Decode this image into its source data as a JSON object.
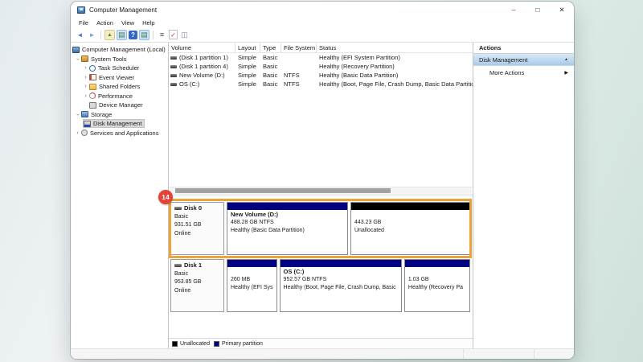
{
  "window": {
    "title": "Computer Management",
    "controls": {
      "minimize": "–",
      "maximize": "□",
      "close": "✕"
    }
  },
  "menu": {
    "items": [
      "File",
      "Action",
      "View",
      "Help"
    ]
  },
  "toolbar": {
    "icons": [
      {
        "name": "back-icon",
        "glyph": "◄"
      },
      {
        "name": "forward-icon",
        "glyph": "►"
      },
      {
        "name": "up-level-icon",
        "glyph": "▲"
      },
      {
        "name": "show-console-tree-icon",
        "glyph": "▤"
      },
      {
        "name": "help-icon",
        "glyph": "?"
      },
      {
        "name": "show-action-pane-icon",
        "glyph": "▤"
      },
      {
        "name": "popup-menu-icon",
        "glyph": "≡"
      },
      {
        "name": "properties-check-icon",
        "glyph": "✓"
      },
      {
        "name": "console-panel-icon",
        "glyph": "◫"
      }
    ]
  },
  "tree": {
    "items": [
      {
        "label": "Computer Management (Local)"
      },
      {
        "label": "System Tools"
      },
      {
        "label": "Task Scheduler"
      },
      {
        "label": "Event Viewer"
      },
      {
        "label": "Shared Folders"
      },
      {
        "label": "Performance"
      },
      {
        "label": "Device Manager"
      },
      {
        "label": "Storage"
      },
      {
        "label": "Disk Management"
      },
      {
        "label": "Services and Applications"
      }
    ]
  },
  "volume_list": {
    "columns": [
      "Volume",
      "Layout",
      "Type",
      "File System",
      "Status"
    ],
    "rows": [
      {
        "name": "(Disk 1 partition 1)",
        "layout": "Simple",
        "type": "Basic",
        "fs": "",
        "status": "Healthy (EFI System Partition)"
      },
      {
        "name": "(Disk 1 partition 4)",
        "layout": "Simple",
        "type": "Basic",
        "fs": "",
        "status": "Healthy (Recovery Partition)"
      },
      {
        "name": "New Volume (D:)",
        "layout": "Simple",
        "type": "Basic",
        "fs": "NTFS",
        "status": "Healthy (Basic Data Partition)"
      },
      {
        "name": "OS (C:)",
        "layout": "Simple",
        "type": "Basic",
        "fs": "NTFS",
        "status": "Healthy (Boot, Page File, Crash Dump, Basic Data Partition)"
      }
    ]
  },
  "disks": [
    {
      "name": "Disk 0",
      "type": "Basic",
      "size": "931.51 GB",
      "status": "Online",
      "partitions": [
        {
          "title": "New Volume  (D:)",
          "size": "488.28 GB NTFS",
          "status": "Healthy (Basic Data Partition)"
        },
        {
          "title": "",
          "size": "443.23 GB",
          "status": "Unallocated"
        }
      ]
    },
    {
      "name": "Disk 1",
      "type": "Basic",
      "size": "953.85 GB",
      "status": "Online",
      "partitions": [
        {
          "title": "",
          "size": "260 MB",
          "status": "Healthy (EFI Sys"
        },
        {
          "title": "OS  (C:)",
          "size": "952.57 GB NTFS",
          "status": "Healthy (Boot, Page File, Crash Dump, Basic"
        },
        {
          "title": "",
          "size": "1.03 GB",
          "status": "Healthy (Recovery Pa"
        }
      ]
    }
  ],
  "annotation": {
    "badge_label": "14"
  },
  "legend": {
    "items": [
      {
        "label": "Unallocated",
        "color": "#000000"
      },
      {
        "label": "Primary partition",
        "color": "#000082"
      }
    ]
  },
  "actions": {
    "header": "Actions",
    "group_label": "Disk Management",
    "more_label": "More Actions"
  },
  "colors": {
    "primary_partition": "#000082",
    "unallocated": "#000000",
    "highlight_box": "#eba43b",
    "annotation_badge": "#e2443a"
  }
}
